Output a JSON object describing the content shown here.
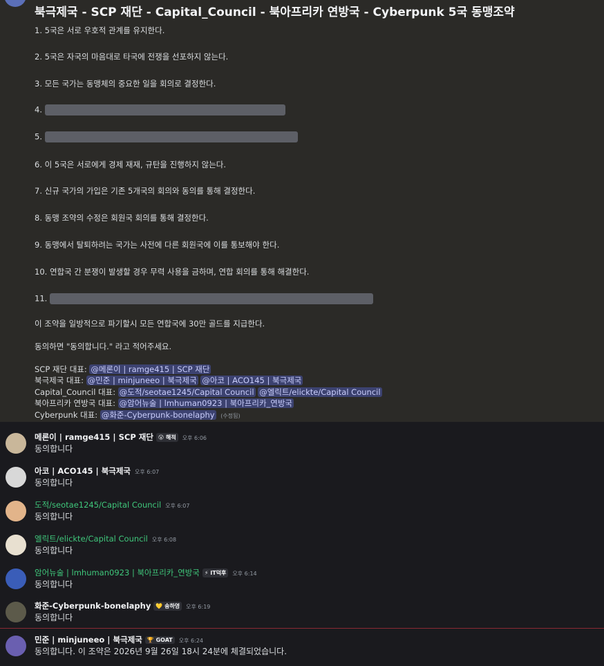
{
  "pinned": {
    "title": "북극제국 - SCP 재단 - Capital_Council - 북아프리카 연방국 - Cyberpunk 5국 동맹조약",
    "rules": [
      {
        "num": "1.",
        "text": "5국은 서로 우호적 관계를 유지한다."
      },
      {
        "num": "2.",
        "text": "5국은 자국의 마음대로 타국에 전쟁을 선포하지 않는다."
      },
      {
        "num": "3.",
        "text": "모든 국가는 동맹체의 중요한 일을 회의로 결정한다."
      },
      {
        "num": "4.",
        "text": ""
      },
      {
        "num": "5.",
        "text": ""
      },
      {
        "num": "6.",
        "text": "이 5국은 서로에게 경제 재재, 규탄을 진행하지 않는다."
      },
      {
        "num": "7.",
        "text": "신규 국가의 가입은 기존 5개국의 회의와 동의를 통해 결정한다."
      },
      {
        "num": "8.",
        "text": "동맹 조약의 수정은 회원국 회의를 통해 결정한다."
      },
      {
        "num": "9.",
        "text": "동맹에서 탈퇴하려는 국가는 사전에 다른 회원국에 이를 통보해야 한다."
      },
      {
        "num": "10.",
        "text": "연합국 간 분쟁이 발생할 경우 무력 사용을 금하며, 연합 회의를 통해 해결한다."
      },
      {
        "num": "11.",
        "text": ""
      }
    ],
    "penalty": "이 조약을 일방적으로 파기할시 모든 연합국에 30만 골드를 지급한다.",
    "consent": "동의하면 \"동의합니다.\" 라고 적어주세요.",
    "representatives": [
      {
        "label": "SCP 재단 대표:",
        "mentions": [
          "@메론이 | ramge415 | SCP 재단"
        ]
      },
      {
        "label": "북극제국 대표:",
        "mentions": [
          "@민준 | minjuneeo | 북극제국",
          "@아코 | ACO145 | 북극제국"
        ]
      },
      {
        "label": "Capital_Council 대표:",
        "mentions": [
          "@도적/seotae1245/Capital Council",
          "@엘릭트/elickte/Capital Council"
        ]
      },
      {
        "label": "북아프리카 연방국 대표:",
        "mentions": [
          "@암어뉴술 | lmhuman0923 | 북아프리카_연방국"
        ]
      },
      {
        "label": "Cyberpunk 대표:",
        "mentions": [
          "@화준-Cyberpunk-bonelaphy"
        ]
      }
    ],
    "edited": "(수정됨)"
  },
  "messages": [
    {
      "user": "메론이 | ramge415 | SCP 재단",
      "badge": "😮 해적",
      "time": "오후 6:06",
      "text": "동의합니다",
      "green": false,
      "avatar_color": "#c9b79a"
    },
    {
      "user": "아코 | ACO145 | 북극제국",
      "badge": "",
      "time": "오후 6:07",
      "text": "동의합니다",
      "green": false,
      "avatar_color": "#d8d8d8"
    },
    {
      "user": "도적/seotae1245/Capital Council",
      "badge": "",
      "time": "오후 6:07",
      "text": "동의합니다",
      "green": true,
      "avatar_color": "#e2b48a"
    },
    {
      "user": "엘릭트/elickte/Capital Council",
      "badge": "",
      "time": "오후 6:08",
      "text": "동의합니다",
      "green": true,
      "avatar_color": "#e8e0d0"
    },
    {
      "user": "암어뉴술 | lmhuman0923 | 북아프리카_연방국",
      "badge": "⚡ IT덕후",
      "time": "오후 6:14",
      "text": "동의합니다",
      "green": true,
      "avatar_color": "#3a5db8"
    },
    {
      "user": "화준-Cyberpunk-bonelaphy",
      "badge": "💛 송하영",
      "time": "오후 6:19",
      "text": "동의합니다",
      "green": false,
      "avatar_color": "#5c5a4a"
    },
    {
      "user": "민준 | minjuneeo | 북극제국",
      "badge": "🏆 GOAT",
      "time": "오후 6:24",
      "text": "동의합니다. 이 조약은 2026년 9월 26일 18시 24분에 체결되었습니다.",
      "green": false,
      "avatar_color": "#6a5fb0"
    }
  ]
}
